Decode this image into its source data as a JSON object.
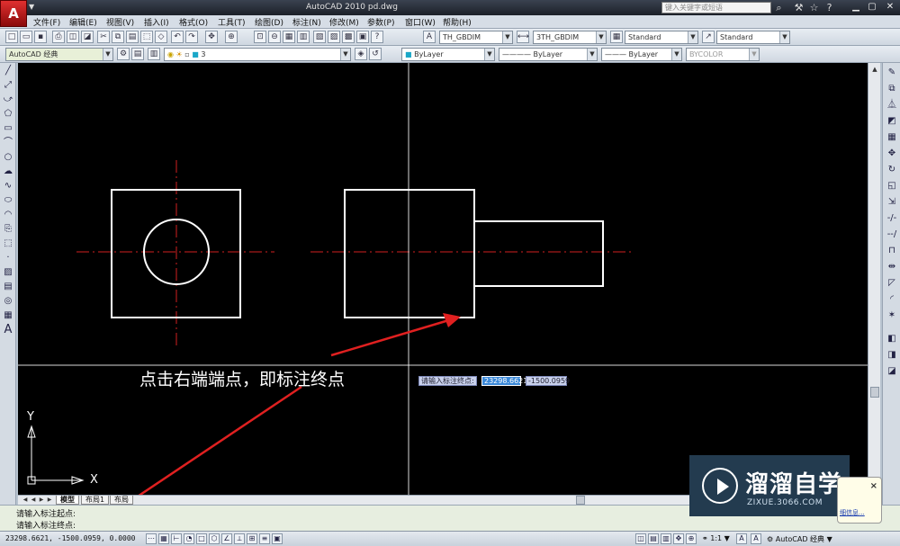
{
  "titlebar": {
    "app_glyph": "A",
    "title": "AutoCAD 2010    pd.dwg",
    "search_placeholder": "键入关键字或短语"
  },
  "menu": [
    "文件(F)",
    "编辑(E)",
    "视图(V)",
    "插入(I)",
    "格式(O)",
    "工具(T)",
    "绘图(D)",
    "标注(N)",
    "修改(M)",
    "参数(P)",
    "窗口(W)",
    "帮助(H)"
  ],
  "toolbar1": {
    "text_style": "TH_GBDIM",
    "dim_style": "3TH_GBDIM",
    "table_style": "Standard",
    "multileader_style": "Standard"
  },
  "toolbar2": {
    "workspace": "AutoCAD 经典",
    "layer": "3",
    "color": "ByLayer",
    "linetype": "ByLayer",
    "lineweight": "ByLayer",
    "plotstyle": "BYCOLOR"
  },
  "canvas": {
    "annotation": "点击右端端点，即标注终点",
    "dynamic_input": {
      "prompt": "请输入标注终点:",
      "x_value": "23298.6621",
      "y_value": "-1500.0959"
    },
    "ucs_x_label": "X",
    "ucs_y_label": "Y"
  },
  "layout_tabs": [
    "模型",
    "布局1",
    "布局"
  ],
  "command_lines": [
    "请输入标注起点:",
    "请输入标注终点:"
  ],
  "status": {
    "coordinates": "23298.6621, -1500.0959, 0.0000",
    "scale": "1:1",
    "workspace": "AutoCAD 经典"
  },
  "watermark": {
    "brand": "溜溜自学",
    "site": "ZIXUE.3066.COM"
  },
  "notification": {
    "close": "×",
    "link": "细信息..."
  },
  "colors": {
    "canvas_bg": "#000000",
    "geometry": "#ffffff",
    "centerline": "#d02020",
    "arrow": "#e02020",
    "accent": "#3a88d8"
  },
  "icons": {
    "app": "autocad-logo-icon",
    "ucs": "ucs-axis-icon"
  }
}
